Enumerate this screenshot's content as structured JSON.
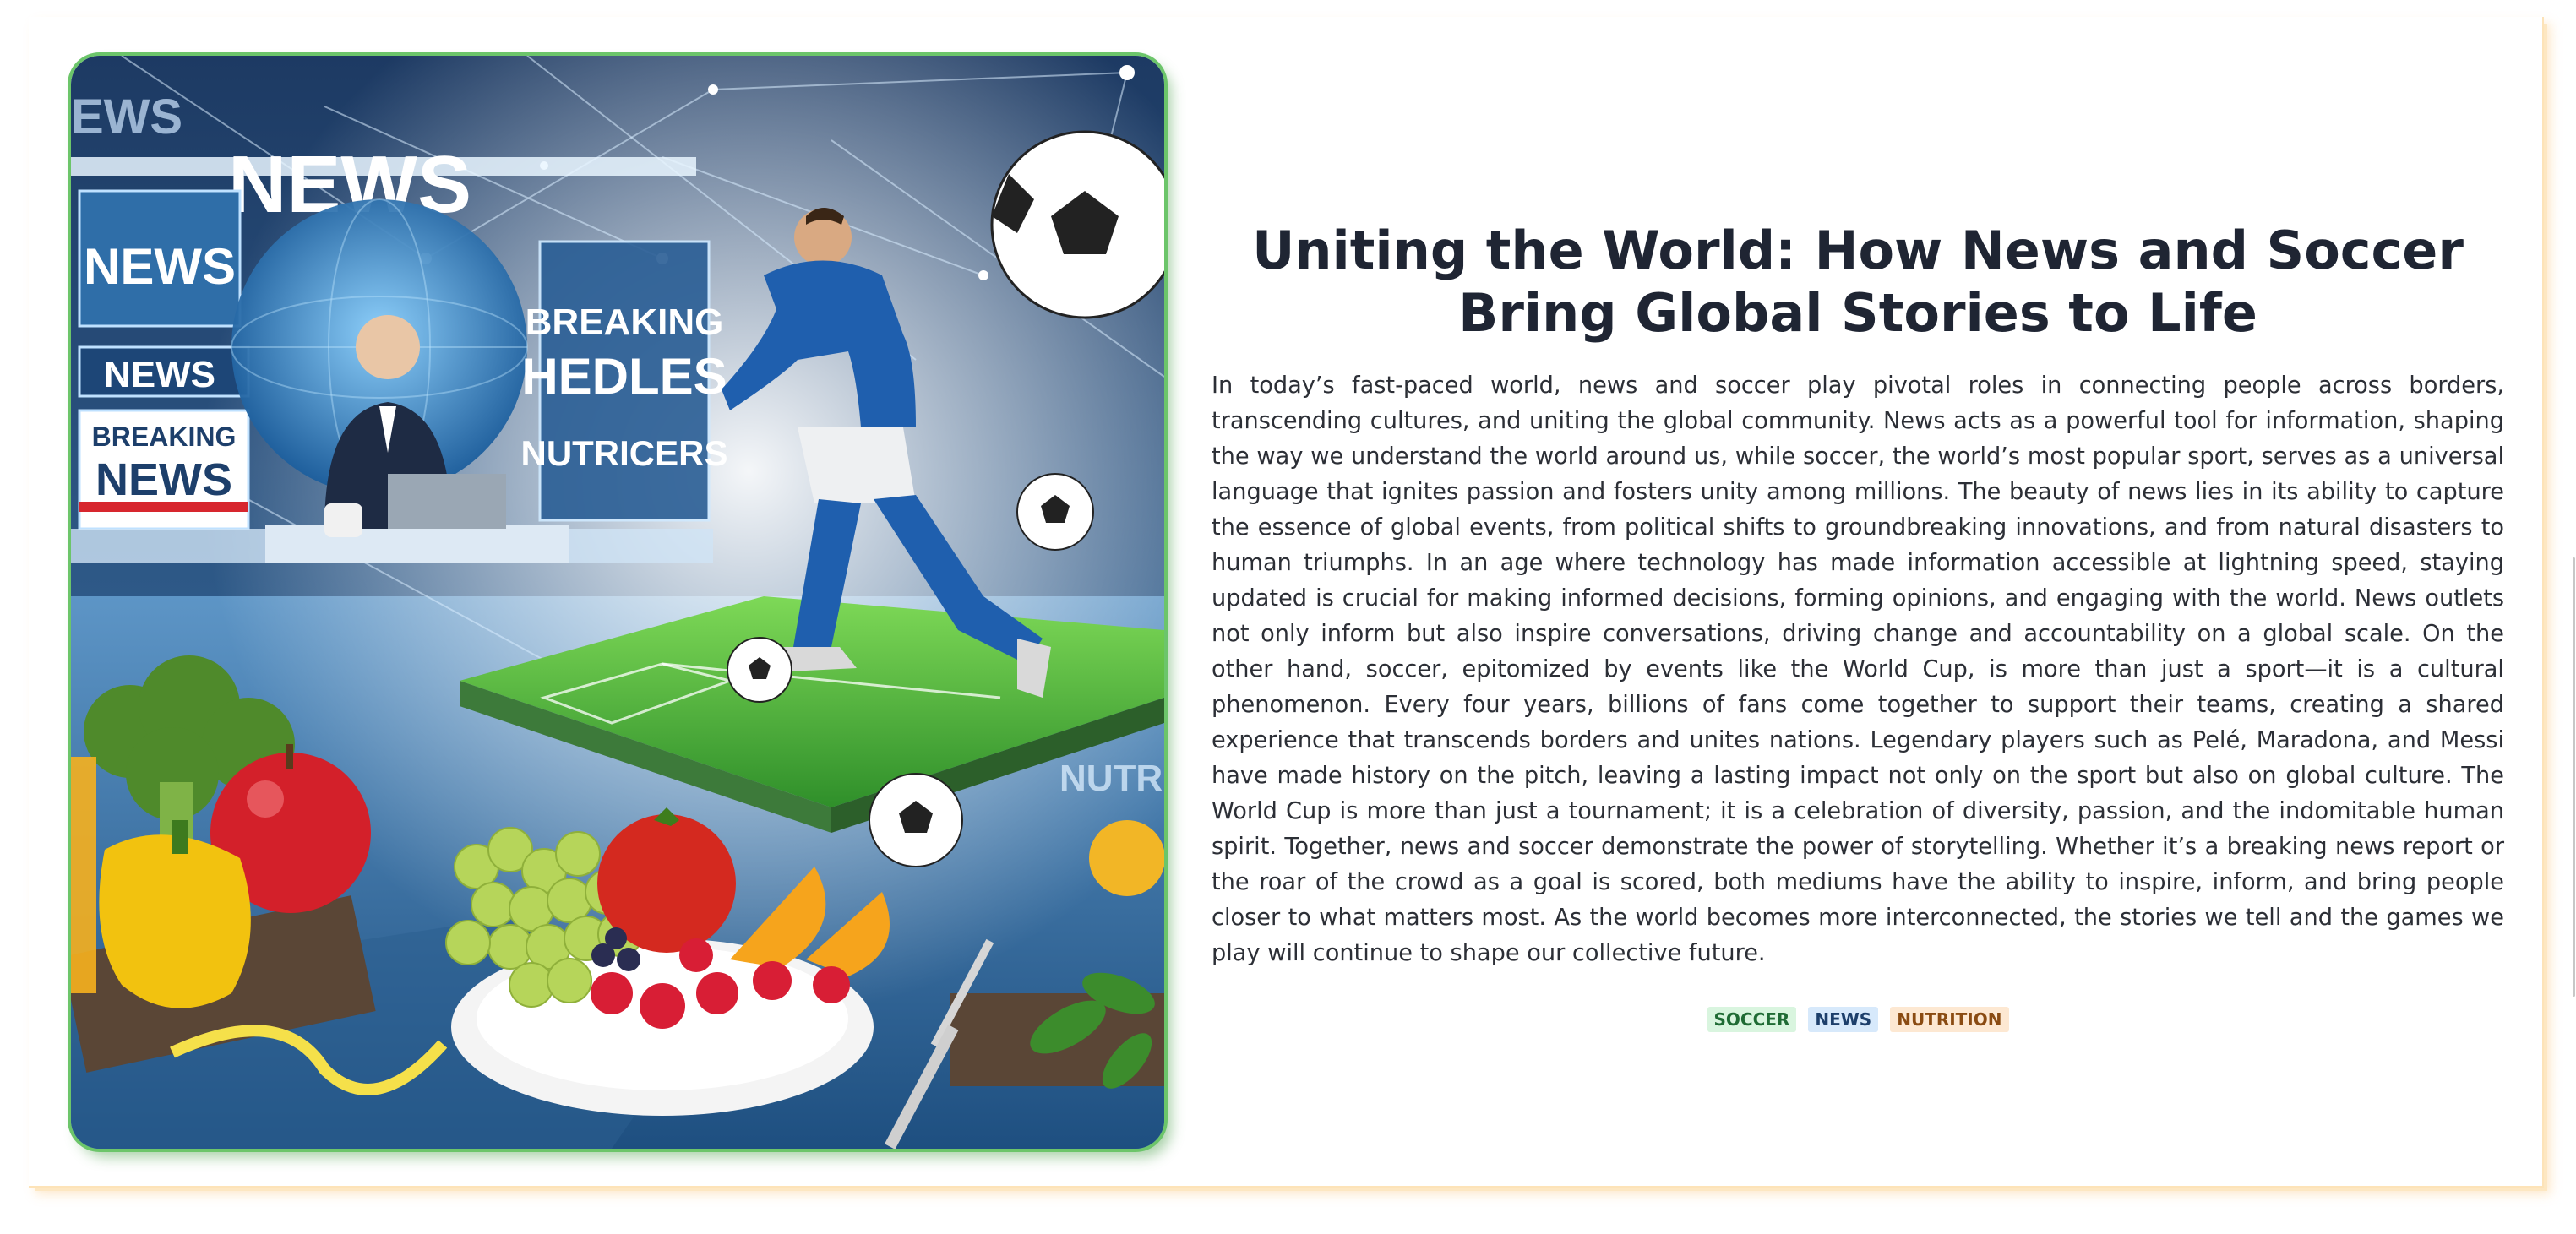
{
  "hero": {
    "icon": "news-soccer-nutrition-collage",
    "labels": [
      "NEWS",
      "NEWS",
      "NEWS",
      "BREAKING",
      "NEWS",
      "BREAKING",
      "HEDLES",
      "NUTRICERS",
      "NUTRIT",
      "EWS"
    ]
  },
  "article": {
    "title": "Uniting the World: How News and Soccer Bring Global Stories to Life",
    "body": "In today’s fast-paced world, news and soccer play pivotal roles in connecting people across borders, transcending cultures, and uniting the global community. News acts as a powerful tool for information, shaping the way we understand the world around us, while soccer, the world’s most popular sport, serves as a universal language that ignites passion and fosters unity among millions. The beauty of news lies in its ability to capture the essence of global events, from political shifts to groundbreaking innovations, and from natural disasters to human triumphs. In an age where technology has made information accessible at lightning speed, staying updated is crucial for making informed decisions, forming opinions, and engaging with the world. News outlets not only inform but also inspire conversations, driving change and accountability on a global scale. On the other hand, soccer, epitomized by events like the World Cup, is more than just a sport—it is a cultural phenomenon. Every four years, billions of fans come together to support their teams, creating a shared experience that transcends borders and unites nations. Legendary players such as Pelé, Maradona, and Messi have made history on the pitch, leaving a lasting impact not only on the sport but also on global culture. The World Cup is more than just a tournament; it is a celebration of diversity, passion, and the indomitable human spirit. Together, news and soccer demonstrate the power of storytelling. Whether it’s a breaking news report or the roar of the crowd as a goal is scored, both mediums have the ability to inspire, inform, and bring people closer to what matters most. As the world becomes more interconnected, the stories we tell and the games we play will continue to shape our collective future.",
    "tags": [
      "SOCCER",
      "NEWS",
      "NUTRITION"
    ]
  },
  "colors": {
    "title": "#1f2533",
    "accent_green": "#6cc56a",
    "card_shadow": "#fde7c2",
    "tag_soccer_bg": "#d9f5df",
    "tag_news_bg": "#d7e9fb",
    "tag_nutrition_bg": "#fde8d2"
  }
}
